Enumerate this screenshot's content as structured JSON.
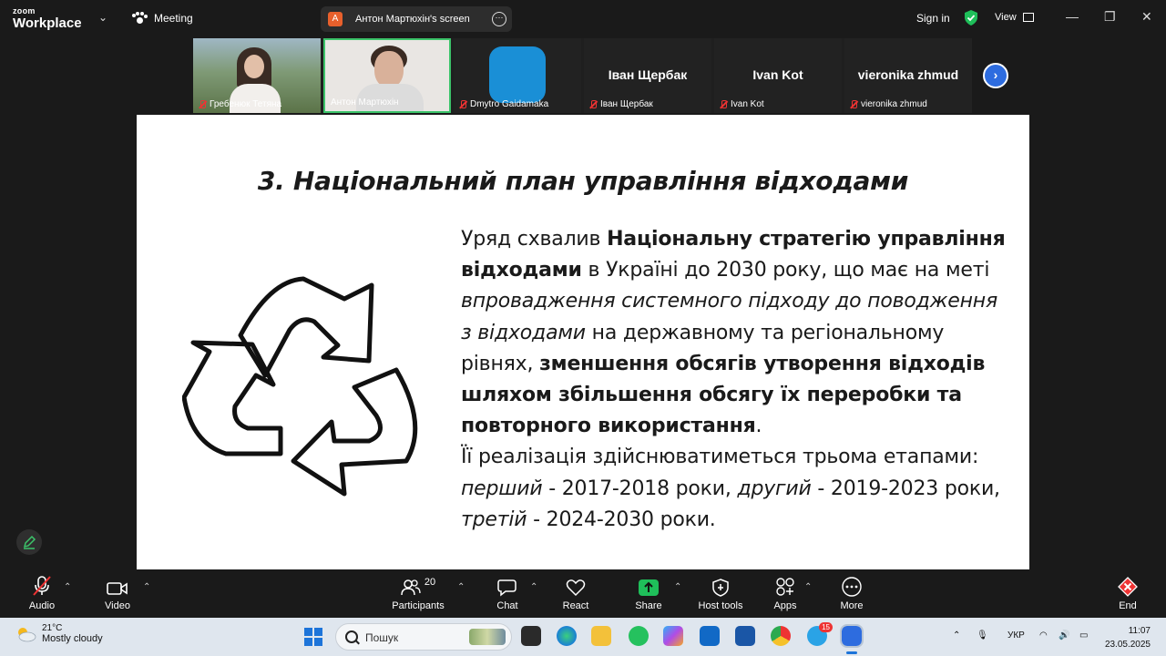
{
  "topbar": {
    "logo_line1": "zoom",
    "logo_line2": "Workplace",
    "meeting_label": "Meeting",
    "share_avatar": "A",
    "share_title": "Антон Мартюхін's screen",
    "sign_in": "Sign in",
    "view_label": "View"
  },
  "participants_strip": {
    "tiles": [
      {
        "name": "Гребенюк Тетяна",
        "type": "video"
      },
      {
        "name": "Антон Мартюхін",
        "type": "video",
        "active": true
      },
      {
        "name": "Dmytro Gaidamaka",
        "type": "avatar"
      },
      {
        "name": "Іван Щербак",
        "big_name": "Іван Щербак",
        "type": "name"
      },
      {
        "name": "Ivan Kot",
        "big_name": "Ivan Kot",
        "type": "name"
      },
      {
        "name": "vieronika zhmud",
        "big_name": "vieronika zhmud",
        "type": "name"
      }
    ]
  },
  "slide": {
    "title": "3. Національний план управління відходами",
    "p1_a": "Уряд схвалив ",
    "p1_b": "Національну стратегію управління відходами",
    "p1_c": " в Україні до 2030 року, що має на меті ",
    "p1_d": "впровадження системного підходу до поводження з відходами",
    "p1_e": " на державному та регіональному рівнях, ",
    "p1_f": "зменшення обсягів утворення відходів шляхом збільшення обсягу їх переробки та повторного використання",
    "p1_g": ".",
    "p2_a": "Її реалізація здійснюватиметься трьома етапами: ",
    "p2_b": "перший",
    "p2_c": " - 2017-2018 роки, ",
    "p2_d": "другий",
    "p2_e": " - 2019-2023 роки, ",
    "p2_f": "третій",
    "p2_g": " - 2024-2030 роки."
  },
  "toolbar": {
    "audio": "Audio",
    "video": "Video",
    "participants": "Participants",
    "participants_count": "20",
    "chat": "Chat",
    "react": "React",
    "share": "Share",
    "host_tools": "Host tools",
    "apps": "Apps",
    "more": "More",
    "end": "End"
  },
  "taskbar": {
    "temp": "21°C",
    "weather": "Mostly cloudy",
    "search_placeholder": "Пошук",
    "telegram_badge": "15",
    "lang": "УКР",
    "time": "11:07",
    "date": "23.05.2025"
  },
  "colors": {
    "accent_blue": "#2d6cdf",
    "active_border": "#3cc46a",
    "share_green": "#1fbf5a",
    "end_red": "#e33"
  }
}
